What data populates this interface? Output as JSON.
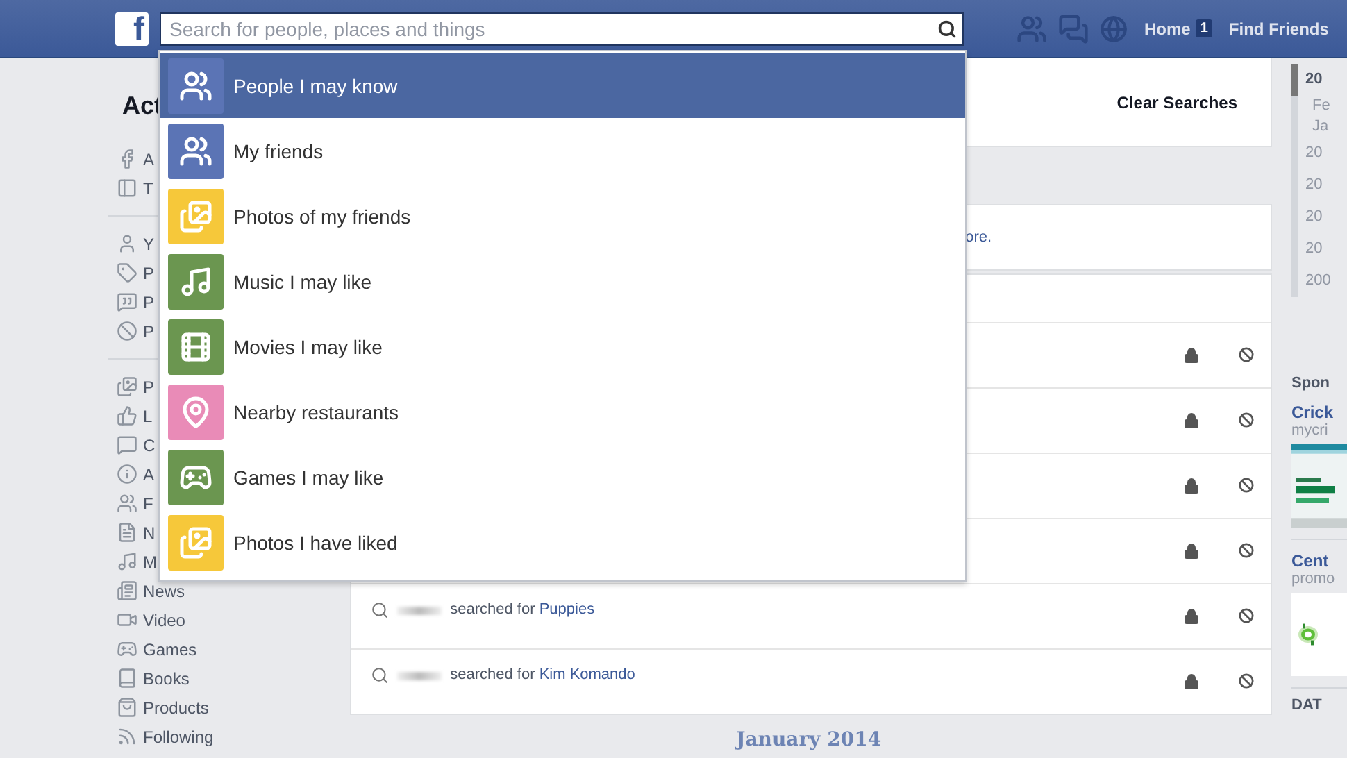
{
  "top_bar": {
    "logo": "f",
    "search": {
      "placeholder": "Search for people, places and things"
    },
    "nav": [
      {
        "label": "Home",
        "badge": "1"
      },
      {
        "label": "Find Friends"
      }
    ]
  },
  "search_suggestions": [
    {
      "label": "People I may know",
      "color": "#5b74b5",
      "selected": true
    },
    {
      "label": "My friends",
      "color": "#5b74b5",
      "selected": false
    },
    {
      "label": "Photos of my friends",
      "color": "#f6c83a",
      "selected": false
    },
    {
      "label": "Music I may like",
      "color": "#6b9650",
      "selected": false
    },
    {
      "label": "Movies I may like",
      "color": "#6b9650",
      "selected": false
    },
    {
      "label": "Nearby restaurants",
      "color": "#e98bb7",
      "selected": false
    },
    {
      "label": "Games I may like",
      "color": "#6b9650",
      "selected": false
    },
    {
      "label": "Photos I have liked",
      "color": "#f6c83a",
      "selected": false
    }
  ],
  "sidebar": {
    "title": "Act",
    "groups": [
      {
        "items": [
          "A",
          "T"
        ]
      },
      {
        "items": [
          "Y",
          "P",
          "P",
          "P"
        ]
      },
      {
        "items": [
          "P",
          "L",
          "C",
          "A",
          "F",
          "N",
          "M",
          "News",
          "Video",
          "Games",
          "Books",
          "Products",
          "Following"
        ]
      }
    ]
  },
  "main": {
    "clear_button": "Clear Searches",
    "notice": "ore.",
    "rows": [
      {
        "kind": "hidden"
      },
      {
        "kind": "hidden"
      },
      {
        "kind": "hidden"
      },
      {
        "kind": "hidden"
      },
      {
        "kind": "search",
        "text": "searched for",
        "query": "Puppies"
      },
      {
        "kind": "search",
        "text": "searched for",
        "query": "Kim Komando"
      }
    ],
    "month_heading": "January 2014"
  },
  "timeline": [
    {
      "label": "20",
      "selected": true
    },
    {
      "label": "Fe",
      "selected": false,
      "sub": true
    },
    {
      "label": "Ja",
      "selected": false,
      "sub": true
    },
    {
      "label": "20",
      "selected": false
    },
    {
      "label": "20",
      "selected": false
    },
    {
      "label": "20",
      "selected": false
    },
    {
      "label": "20",
      "selected": false
    },
    {
      "label": "200",
      "selected": false
    }
  ],
  "sponsored": {
    "heading": "Spon",
    "ads": [
      {
        "title": "Crick",
        "source": "mycri",
        "kind": "picture"
      },
      {
        "title": "Cent",
        "source": "promo",
        "kind": "picture"
      }
    ],
    "next_heading": "DAT"
  }
}
